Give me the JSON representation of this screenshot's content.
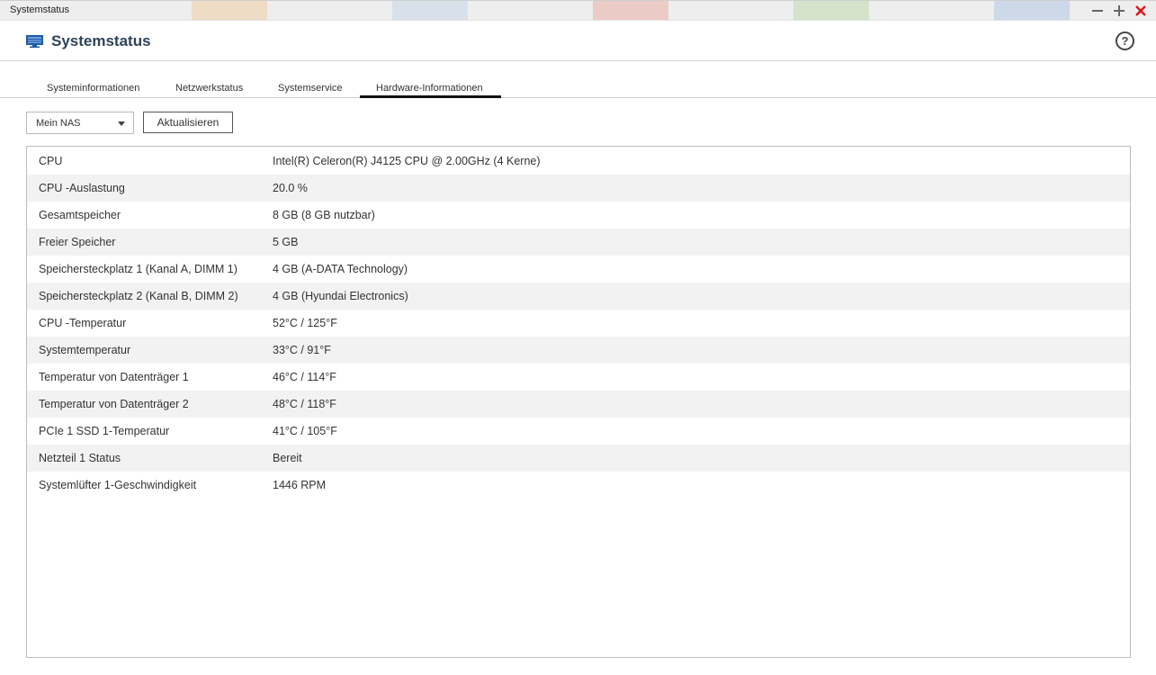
{
  "window": {
    "title": "Systemstatus"
  },
  "app": {
    "title": "Systemstatus"
  },
  "colors": {
    "accent": "#1e5aa8",
    "close": "#e0141e",
    "tab_active": "#111111"
  },
  "tabs": [
    {
      "label": "Systeminformationen",
      "active": false
    },
    {
      "label": "Netzwerkstatus",
      "active": false
    },
    {
      "label": "Systemservice",
      "active": false
    },
    {
      "label": "Hardware-Informationen",
      "active": true
    }
  ],
  "toolbar": {
    "device_select": "Mein NAS",
    "refresh_label": "Aktualisieren"
  },
  "hardware": [
    {
      "label": "CPU",
      "value": "Intel(R) Celeron(R) J4125 CPU @ 2.00GHz (4 Kerne)"
    },
    {
      "label": "CPU -Auslastung",
      "value": "20.0 %"
    },
    {
      "label": "Gesamtspeicher",
      "value": "8 GB (8 GB nutzbar)"
    },
    {
      "label": "Freier Speicher",
      "value": "5 GB"
    },
    {
      "label": "Speichersteckplatz 1 (Kanal A, DIMM 1)",
      "value": "4 GB (A-DATA Technology)"
    },
    {
      "label": "Speichersteckplatz 2 (Kanal B, DIMM 2)",
      "value": "4 GB (Hyundai Electronics)"
    },
    {
      "label": "CPU -Temperatur",
      "value": "52°C / 125°F"
    },
    {
      "label": "Systemtemperatur",
      "value": "33°C / 91°F"
    },
    {
      "label": "Temperatur von Datenträger 1",
      "value": "46°C / 114°F"
    },
    {
      "label": "Temperatur von Datenträger 2",
      "value": "48°C / 118°F"
    },
    {
      "label": "PCIe 1 SSD 1-Temperatur",
      "value": "41°C / 105°F"
    },
    {
      "label": "Netzteil 1 Status",
      "value": "Bereit"
    },
    {
      "label": "Systemlüfter 1-Geschwindigkeit",
      "value": "1446 RPM"
    }
  ]
}
